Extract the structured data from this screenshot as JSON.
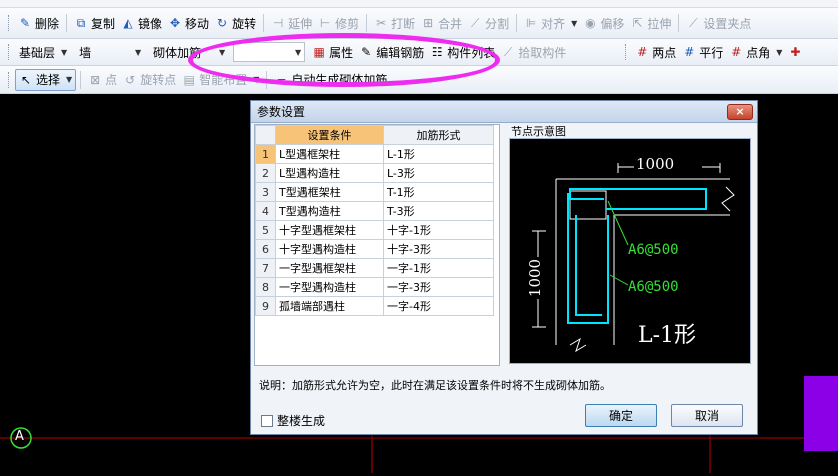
{
  "colors": {
    "accent": "#ee2cf0",
    "cyan": "#00e5ff",
    "green": "#35e035",
    "purple": "#8b00e6",
    "red_line": "#c00000"
  },
  "toolbar1": {
    "items": [
      {
        "label": "删除",
        "icon": "eraser-icon"
      },
      {
        "label": "复制",
        "icon": "copy-icon"
      },
      {
        "label": "镜像",
        "icon": "mirror-icon"
      },
      {
        "label": "移动",
        "icon": "move-icon"
      },
      {
        "label": "旋转",
        "icon": "rotate-icon"
      },
      {
        "label": "延伸",
        "icon": "extend-icon"
      },
      {
        "label": "修剪",
        "icon": "trim-icon"
      },
      {
        "label": "打断",
        "icon": "break-icon"
      },
      {
        "label": "合并",
        "icon": "merge-icon"
      },
      {
        "label": "分割",
        "icon": "split-icon"
      },
      {
        "label": "对齐",
        "icon": "align-icon"
      },
      {
        "label": "偏移",
        "icon": "offset-icon"
      },
      {
        "label": "拉伸",
        "icon": "stretch-icon"
      },
      {
        "label": "设置夹点",
        "icon": "grip-icon"
      }
    ]
  },
  "toolbar2": {
    "floor": "基础层",
    "element": "墙",
    "rebar": "砌体加筋",
    "empty_combo": "",
    "props": "属性",
    "edit_rebar": "编辑钢筋",
    "component_list": "构件列表",
    "pick": "拾取构件",
    "two_point": "两点",
    "parallel": "平行",
    "point_angle": "点角"
  },
  "toolbar3": {
    "select": "选择",
    "point": "点",
    "rotate_point": "旋转点",
    "smart_layout": "智能布置",
    "auto_gen": "自动生成砌体加筋"
  },
  "dialog": {
    "title": "参数设置",
    "close": "×",
    "col_condition": "设置条件",
    "col_form": "加筋形式",
    "rows": [
      {
        "n": "1",
        "cond": "L型遇框架柱",
        "form": "L-1形"
      },
      {
        "n": "2",
        "cond": "L型遇构造柱",
        "form": "L-3形"
      },
      {
        "n": "3",
        "cond": "T型遇框架柱",
        "form": "T-1形"
      },
      {
        "n": "4",
        "cond": "T型遇构造柱",
        "form": "T-3形"
      },
      {
        "n": "5",
        "cond": "十字型遇框架柱",
        "form": "十字-1形"
      },
      {
        "n": "6",
        "cond": "十字型遇构造柱",
        "form": "十字-3形"
      },
      {
        "n": "7",
        "cond": "一字型遇框架柱",
        "form": "一字-1形"
      },
      {
        "n": "8",
        "cond": "一字型遇构造柱",
        "form": "一字-3形"
      },
      {
        "n": "9",
        "cond": "孤墙端部遇柱",
        "form": "一字-4形"
      }
    ],
    "preview_label": "节点示意图",
    "dim_h": "1000",
    "dim_v": "1000",
    "rebar1": "A6@500",
    "rebar2": "A6@500",
    "shape": "L-1形",
    "desc": "说明：加筋形式允许为空，此时在满足该设置条件时将不生成砌体加筋。",
    "whole_floor": "整楼生成",
    "ok": "确定",
    "cancel": "取消"
  },
  "canvas": {
    "axis_label": "A"
  }
}
